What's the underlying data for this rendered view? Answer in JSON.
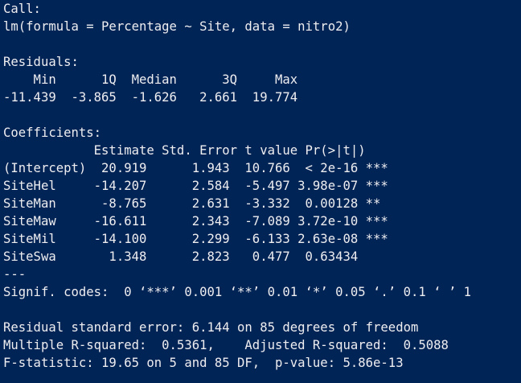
{
  "console": {
    "lines": [
      "Call:",
      "lm(formula = Percentage ~ Site, data = nitro2)",
      "",
      "Residuals:",
      "    Min      1Q  Median      3Q     Max ",
      "-11.439  -3.865  -1.626   2.661  19.774 ",
      "",
      "Coefficients:",
      "            Estimate Std. Error t value Pr(>|t|)    ",
      "(Intercept)  20.919      1.943  10.766  < 2e-16 ***",
      "SiteHel     -14.207      2.584  -5.497 3.98e-07 ***",
      "SiteMan      -8.765      2.631  -3.332  0.00128 ** ",
      "SiteMaw     -16.611      2.343  -7.089 3.72e-10 ***",
      "SiteMil     -14.100      2.299  -6.133 2.63e-08 ***",
      "SiteSwa       1.348      2.823   0.477  0.63434    ",
      "---",
      "Signif. codes:  0 ‘***’ 0.001 ‘**’ 0.01 ‘*’ 0.05 ‘.’ 0.1 ‘ ’ 1",
      "",
      "Residual standard error: 6.144 on 85 degrees of freedom",
      "Multiple R-squared:  0.5361,\tAdjusted R-squared:  0.5088 ",
      "F-statistic: 19.65 on 5 and 85 DF,  p-value: 5.86e-13"
    ]
  }
}
